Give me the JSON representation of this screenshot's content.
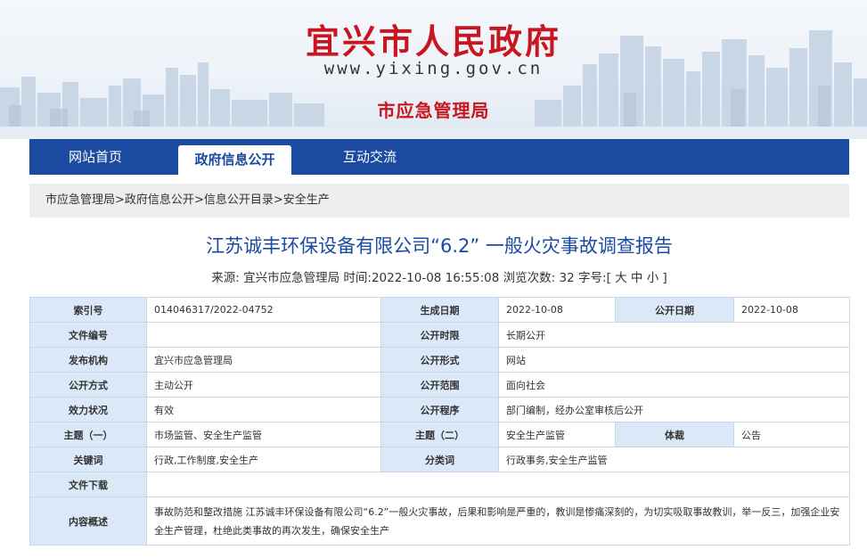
{
  "header": {
    "site_title": "宜兴市人民政府",
    "site_url": "www.yixing.gov.cn",
    "department": "市应急管理局"
  },
  "nav": {
    "items": [
      {
        "label": "网站首页",
        "active": false
      },
      {
        "label": "政府信息公开",
        "active": true
      },
      {
        "label": "互动交流",
        "active": false
      }
    ]
  },
  "breadcrumb": {
    "items": [
      "市应急管理局",
      "政府信息公开",
      "信息公开目录",
      "安全生产"
    ],
    "separator": ">"
  },
  "article": {
    "title": "江苏诚丰环保设备有限公司“6.2” 一般火灾事故调查报告",
    "source_label": "来源:",
    "source": "宜兴市应急管理局",
    "time_label": "时间:",
    "time": "2022-10-08 16:55:08",
    "views_label": "浏览次数:",
    "views": "32",
    "font_label": "字号:",
    "font_open": "[",
    "font_large": "大",
    "font_medium": "中",
    "font_small": "小",
    "font_close": "]"
  },
  "info": {
    "index_label": "索引号",
    "index": "014046317/2022-04752",
    "gen_date_label": "生成日期",
    "gen_date": "2022-10-08",
    "pub_date_label": "公开日期",
    "pub_date": "2022-10-08",
    "doc_no_label": "文件编号",
    "doc_no": "",
    "pub_period_label": "公开时限",
    "pub_period": "长期公开",
    "issuer_label": "发布机构",
    "issuer": "宜兴市应急管理局",
    "pub_form_label": "公开形式",
    "pub_form": "网站",
    "pub_way_label": "公开方式",
    "pub_way": "主动公开",
    "pub_scope_label": "公开范围",
    "pub_scope": "面向社会",
    "validity_label": "效力状况",
    "validity": "有效",
    "pub_process_label": "公开程序",
    "pub_process": "部门编制，经办公室审核后公开",
    "topic1_label": "主题（一）",
    "topic1": "市场监管、安全生产监管",
    "topic2_label": "主题（二）",
    "topic2": "安全生产监管",
    "genre_label": "体裁",
    "genre": "公告",
    "keywords_label": "关键词",
    "keywords": "行政,工作制度,安全生产",
    "category_label": "分类词",
    "category": "行政事务,安全生产监管",
    "download_label": "文件下载",
    "download": "",
    "summary_label": "内容概述",
    "summary": "事故防范和整改措施 江苏诚丰环保设备有限公司“6.2”一般火灾事故，后果和影响是严重的，教训是惨痛深刻的，为切实吸取事故教训，举一反三，加强企业安全生产管理，杜绝此类事故的再次发生，确保安全生产"
  },
  "colors": {
    "brand_red": "#c8161e",
    "nav_blue": "#1b4ba0",
    "label_bg": "#dbe8f8",
    "border": "#c9d6e8"
  }
}
